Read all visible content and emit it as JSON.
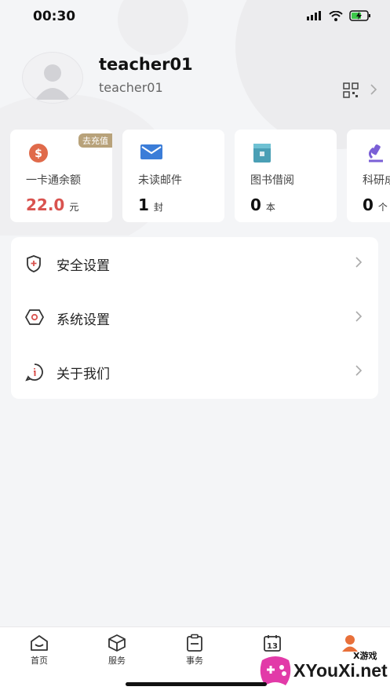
{
  "status": {
    "time": "00:30"
  },
  "profile": {
    "name": "teacher01",
    "username": "teacher01"
  },
  "cards": [
    {
      "label": "一卡通余额",
      "value": "22.0",
      "unit": "元",
      "badge": "去充值",
      "icon": "dollar-coin-icon",
      "color": "#e06a4a"
    },
    {
      "label": "未读邮件",
      "value": "1",
      "unit": "封",
      "icon": "mail-icon",
      "color": "#3b7dd8"
    },
    {
      "label": "图书借阅",
      "value": "0",
      "unit": "本",
      "icon": "book-icon",
      "color": "#4a9fb5"
    },
    {
      "label": "科研成",
      "value": "0",
      "unit": "个",
      "icon": "microscope-icon",
      "color": "#7a5fd6"
    }
  ],
  "settings": [
    {
      "label": "安全设置",
      "icon": "shield-icon"
    },
    {
      "label": "系统设置",
      "icon": "gear-hexagon-icon"
    },
    {
      "label": "关于我们",
      "icon": "info-bubble-icon"
    }
  ],
  "tabs": [
    {
      "label": "首页",
      "icon": "home-icon"
    },
    {
      "label": "服务",
      "icon": "cube-icon"
    },
    {
      "label": "事务",
      "icon": "clipboard-icon"
    },
    {
      "label": "",
      "icon": "calendar-icon",
      "day": "13"
    },
    {
      "label": "",
      "icon": "profile-icon"
    }
  ],
  "watermark": {
    "brand": "X游戏",
    "site": "XYouXi.net"
  },
  "colors": {
    "accent_red": "#d9534f",
    "badge_gold": "#b8a27a",
    "active_tab": "#e8703a"
  }
}
